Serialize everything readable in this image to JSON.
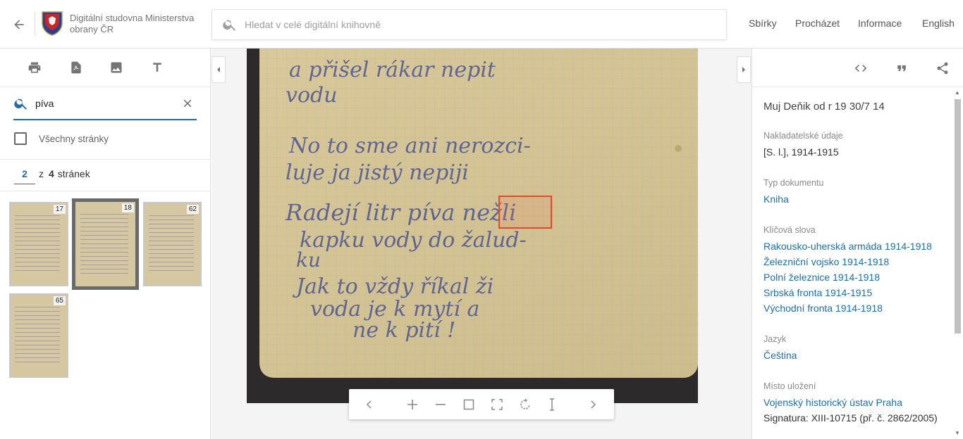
{
  "header": {
    "brand": "Digitální studovna Ministerstva obrany ČR",
    "search_placeholder": "Hledat v celé digitální knihovně",
    "nav": [
      "Sbírky",
      "Procházet",
      "Informace",
      "English"
    ]
  },
  "left_panel": {
    "tools": [
      "print-icon",
      "pdf-icon",
      "image-icon",
      "text-icon"
    ],
    "search_value": "píva",
    "all_pages_label": "Všechny stránky",
    "pager": {
      "current": "2",
      "of": "z",
      "total": "4",
      "unit": "stránek"
    },
    "thumbnails": [
      "17",
      "18",
      "62",
      "65"
    ],
    "active_thumbnail": "18"
  },
  "viewer": {
    "controls": [
      "prev-icon",
      "zoom-in-icon",
      "zoom-out-icon",
      "fit-icon",
      "fullscreen-icon",
      "rotate-icon",
      "text-select-icon",
      "next-icon"
    ],
    "handwriting": [
      "a přišel rákar nepit",
      "vodu",
      "No to sme ani nerozci-",
      "luje ja jistý nepiji",
      "Radejí litr píva nežli",
      "kapku vody do žalud-",
      "ku",
      "Jak to vždy říkal ži",
      "voda je k mytí a",
      "ne k pití !"
    ]
  },
  "right_panel": {
    "tools": [
      "code-icon",
      "quote-icon",
      "share-icon"
    ],
    "title": "Muj Deňik od r 19 30/7 14",
    "publisher_label": "Nakladatelské údaje",
    "publisher_value": "[S. l.], 1914-1915",
    "doctype_label": "Typ dokumentu",
    "doctype_value": "Kniha",
    "keywords_label": "Klíčová slova",
    "keywords": [
      "Rakousko-uherská armáda 1914-1918",
      "Železniční vojsko 1914-1918",
      "Polní železnice 1914-1918",
      "Srbská fronta 1914-1915",
      "Východní fronta 1914-1918"
    ],
    "language_label": "Jazyk",
    "language_value": "Čeština",
    "location_label": "Místo uložení",
    "location_value": "Vojenský historický ústav Praha",
    "signature": "Signatura: XIII-10715 (př. č. 2862/2005)"
  },
  "colors": {
    "accent": "#1e6fa8",
    "highlight": "#e8492b",
    "paper": "#d8c99c"
  }
}
